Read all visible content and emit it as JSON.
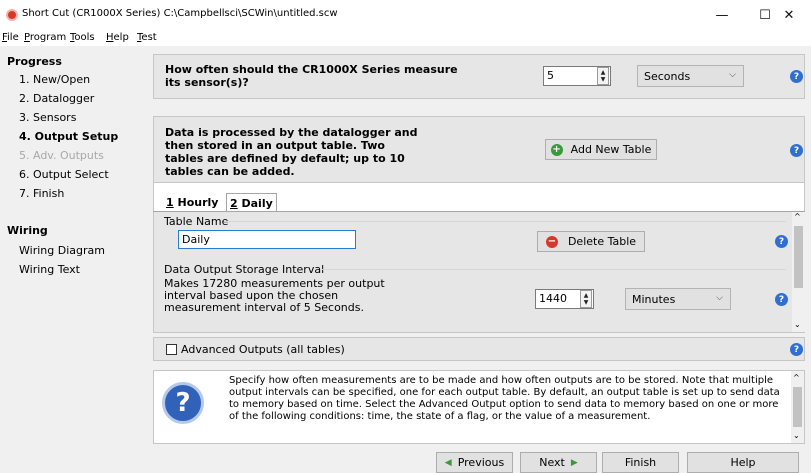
{
  "window": {
    "title": "Short Cut (CR1000X Series) C:\\Campbellsci\\SCWin\\untitled.scw",
    "minimize": "—",
    "maximize": "☐",
    "close": "✕"
  },
  "menu": [
    "File",
    "Program",
    "Tools",
    "Help",
    "Test"
  ],
  "sidebar": {
    "progress_heading": "Progress",
    "progress_items": [
      {
        "label": "1. New/Open",
        "state": "normal"
      },
      {
        "label": "2. Datalogger",
        "state": "normal"
      },
      {
        "label": "3. Sensors",
        "state": "normal"
      },
      {
        "label": "4. Output Setup",
        "state": "active"
      },
      {
        "label": "5. Adv. Outputs",
        "state": "disabled"
      },
      {
        "label": "6. Output Select",
        "state": "normal"
      },
      {
        "label": "7. Finish",
        "state": "normal"
      }
    ],
    "wiring_heading": "Wiring",
    "wiring_items": [
      "Wiring Diagram",
      "Wiring Text"
    ]
  },
  "measure": {
    "question": "How often should the CR1000X Series measure its sensor(s)?",
    "value": "5",
    "unit": "Seconds"
  },
  "tables_info": {
    "text": "Data is processed by the datalogger and then stored in an output table. Two tables are defined by default; up to 10 tables can be added.",
    "add_button": "Add New Table"
  },
  "tabs": [
    {
      "num": "1",
      "label": "Hourly",
      "selected": false
    },
    {
      "num": "2",
      "label": "Daily",
      "selected": true
    }
  ],
  "table_name": {
    "label": "Table Name",
    "value": "Daily",
    "delete_button": "Delete Table"
  },
  "storage": {
    "label": "Data Output Storage Interval",
    "description": "Makes 17280 measurements per output interval based upon the chosen measurement interval of 5 Seconds.",
    "value": "1440",
    "unit": "Minutes"
  },
  "advanced": {
    "label": "Advanced Outputs (all tables)",
    "checked": false
  },
  "help_text": "Specify how often measurements are to be made and how often outputs are to be stored. Note that multiple output intervals can be specified, one for each output table. By default, an output table is set up to send data to memory based on time. Select the Advanced Output option to send data to memory based on one or more of the following conditions: time, the state of a flag, or the value of a measurement.",
  "nav": {
    "previous": "Previous",
    "next": "Next",
    "finish": "Finish",
    "help": "Help"
  },
  "colors": {
    "help_icon": "#2f6fd1",
    "add_icon": "#3a9a3a",
    "delete_icon": "#d8382b",
    "panel": "#e6e6e6"
  }
}
